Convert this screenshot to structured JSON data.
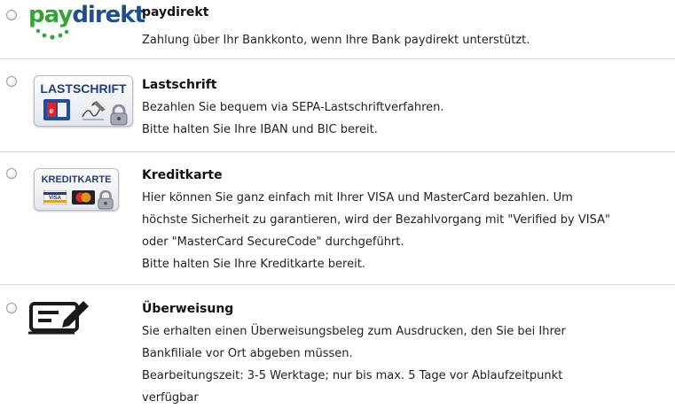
{
  "payment_options": [
    {
      "id": "paydirekt",
      "logo": {
        "pay": "pay",
        "direkt": "direkt"
      },
      "title": "paydirekt",
      "lines": [
        "Zahlung über Ihr Bankkonto, wenn Ihre Bank paydirekt unterstützt."
      ]
    },
    {
      "id": "lastschrift",
      "badge_label": "LASTSCHRIFT",
      "title": "Lastschrift",
      "lines": [
        "Bezahlen Sie bequem via SEPA-Lastschriftverfahren.",
        "Bitte halten Sie Ihre IBAN und BIC bereit."
      ]
    },
    {
      "id": "kreditkarte",
      "badge_label": "KREDITKARTE",
      "title": "Kreditkarte",
      "lines": [
        "Hier können Sie ganz einfach mit Ihrer VISA und MasterCard bezahlen. Um",
        "höchste Sicherheit zu garantieren, wird der Bezahlvorgang mit \"Verified by VISA\"",
        "oder \"MasterCard SecureCode\" durchgeführt.",
        "Bitte halten Sie Ihre Kreditkarte bereit."
      ]
    },
    {
      "id": "ueberweisung",
      "title": "Überweisung",
      "lines": [
        "Sie erhalten einen Überweisungsbeleg zum Ausdrucken, den Sie bei Ihrer",
        "Bankfiliale vor Ort abgeben müssen.",
        "Bearbeitungszeit: 3-5 Werktage; nur bis max. 5 Tage vor Ablaufzeitpunkt",
        "verfügbar"
      ]
    }
  ],
  "colors": {
    "paydirekt_green": "#36a23a",
    "paydirekt_blue": "#1d4e8f",
    "badge_label": "#1f3f7a",
    "separator": "#dcdcdc"
  }
}
